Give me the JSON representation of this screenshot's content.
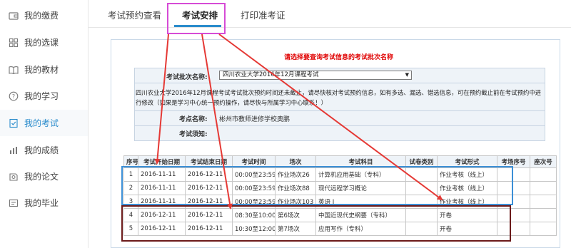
{
  "sidebar": {
    "items": [
      {
        "label": "我的缴费",
        "icon": "wallet-icon",
        "active": false
      },
      {
        "label": "我的选课",
        "icon": "grid-icon",
        "active": false
      },
      {
        "label": "我的教材",
        "icon": "book-icon",
        "active": false
      },
      {
        "label": "我的学习",
        "icon": "question-icon",
        "active": false
      },
      {
        "label": "我的考试",
        "icon": "exam-icon",
        "active": true
      },
      {
        "label": "我的成绩",
        "icon": "bar-chart-icon",
        "active": false
      },
      {
        "label": "我的论文",
        "icon": "paper-icon",
        "active": false
      },
      {
        "label": "我的毕业",
        "icon": "graduation-icon",
        "active": false
      }
    ]
  },
  "tabs": [
    {
      "label": "考试预约查看"
    },
    {
      "label": "考试安排"
    },
    {
      "label": "打印准考证"
    }
  ],
  "colors": {
    "accent": "#2b8ccc",
    "highlight_pink": "#d64bd6",
    "highlight_blue": "#3b8fd6",
    "highlight_dark": "#6b1a1a",
    "arrow_red": "#e53935",
    "prompt_red": "#e00000"
  },
  "prompt": "请选择要查询考试信息的考试批次名称",
  "batch": {
    "label": "考试批次名称:",
    "selected": "四川农业大学2016年12月课程考试"
  },
  "notice": "四川农业大学2016年12月课程考试考试批次预约时间还未截止，请尽快核对考试预约信息，如有多选、漏选、错选信息，可在预约截止前在考试预约中进行修改（如果是学习中心统一预约操作，请尽快与所属学习中心联系！）",
  "site": {
    "label": "考点名称:",
    "value": "彬州市教师进修学校奥鹏"
  },
  "exam_notice": {
    "label": "考试须知:",
    "value": ""
  },
  "table": {
    "headers": [
      "序号",
      "考试开始日期",
      "考试结束日期",
      "考试时间",
      "场次",
      "考试科目",
      "试卷类别",
      "考试形式",
      "考场序号",
      "座次号"
    ],
    "rows": [
      [
        "1",
        "2016-11-11",
        "2016-12-11",
        "00:00至23:59",
        "作业场次26",
        "计算机应用基础（专科）",
        "",
        "作业考核（线上）",
        "",
        ""
      ],
      [
        "2",
        "2016-11-11",
        "2016-12-11",
        "00:00至23:59",
        "作业场次88",
        "现代远程学习概论",
        "",
        "作业考核（线上）",
        "",
        ""
      ],
      [
        "3",
        "2016-11-11",
        "2016-12-11",
        "00:00至23:59",
        "作业场次103",
        "英语 I",
        "",
        "作业考核（线上）",
        "",
        ""
      ],
      [
        "4",
        "2016-12-11",
        "2016-12-11",
        "08:30至10:00",
        "第6场次",
        "中国近现代史纲要（专科）",
        "",
        "开卷",
        "",
        ""
      ],
      [
        "5",
        "2016-12-11",
        "2016-12-11",
        "10:30至12:00",
        "第7场次",
        "应用写作（专科）",
        "",
        "开卷",
        "",
        ""
      ]
    ]
  }
}
